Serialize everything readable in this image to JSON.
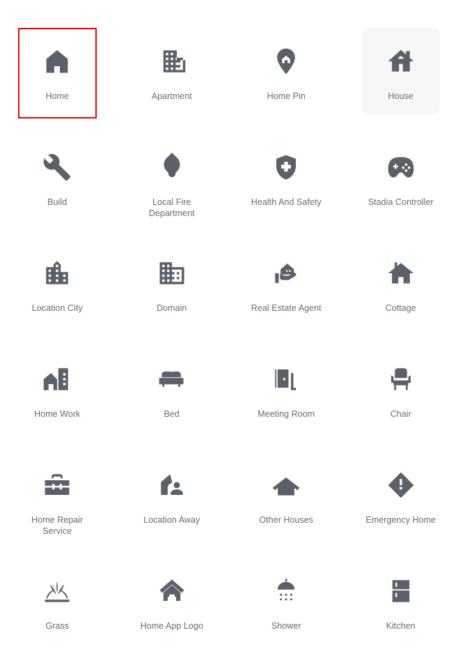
{
  "grid": {
    "columns": 4,
    "rows": 6,
    "accent_selected_color": "#ee0000",
    "hover_background_color": "#f6f7f8",
    "icon_color": "#5c6169",
    "label_color": "#646b78",
    "page_background": "#ffffff"
  },
  "icons": [
    {
      "label": "Home",
      "icon": "home-icon",
      "state": "selected"
    },
    {
      "label": "Apartment",
      "icon": "apartment-icon",
      "state": "default"
    },
    {
      "label": "Home Pin",
      "icon": "home-pin-icon",
      "state": "default"
    },
    {
      "label": "House",
      "icon": "house-icon",
      "state": "hovered"
    },
    {
      "label": "Build",
      "icon": "wrench-build-icon",
      "state": "default"
    },
    {
      "label": "Local Fire Department",
      "icon": "local-fire-department-icon",
      "state": "default"
    },
    {
      "label": "Health And Safety",
      "icon": "health-and-safety-icon",
      "state": "default"
    },
    {
      "label": "Stadia Controller",
      "icon": "stadia-controller-icon",
      "state": "default"
    },
    {
      "label": "Location City",
      "icon": "location-city-icon",
      "state": "default"
    },
    {
      "label": "Domain",
      "icon": "domain-icon",
      "state": "default"
    },
    {
      "label": "Real Estate Agent",
      "icon": "real-estate-agent-icon",
      "state": "default"
    },
    {
      "label": "Cottage",
      "icon": "cottage-icon",
      "state": "default"
    },
    {
      "label": "Home Work",
      "icon": "home-work-icon",
      "state": "default"
    },
    {
      "label": "Bed",
      "icon": "bed-icon",
      "state": "default"
    },
    {
      "label": "Meeting Room",
      "icon": "meeting-room-icon",
      "state": "default"
    },
    {
      "label": "Chair",
      "icon": "chair-icon",
      "state": "default"
    },
    {
      "label": "Home Repair Service",
      "icon": "home-repair-service-icon",
      "state": "default"
    },
    {
      "label": "Location Away",
      "icon": "location-away-icon",
      "state": "default"
    },
    {
      "label": "Other Houses",
      "icon": "other-houses-icon",
      "state": "default"
    },
    {
      "label": "Emergency Home",
      "icon": "emergency-home-icon",
      "state": "default"
    },
    {
      "label": "Grass",
      "icon": "grass-icon",
      "state": "default"
    },
    {
      "label": "Home App Logo",
      "icon": "home-app-logo-icon",
      "state": "default"
    },
    {
      "label": "Shower",
      "icon": "shower-icon",
      "state": "default"
    },
    {
      "label": "Kitchen",
      "icon": "kitchen-icon",
      "state": "default"
    }
  ]
}
